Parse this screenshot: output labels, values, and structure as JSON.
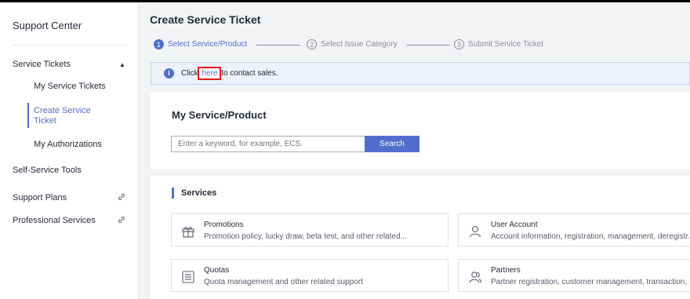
{
  "sidebar": {
    "title": "Support Center",
    "items": [
      {
        "label": "Service Tickets"
      },
      {
        "label": "My Service Tickets"
      },
      {
        "label": "Create Service Ticket"
      },
      {
        "label": "My Authorizations"
      },
      {
        "label": "Self-Service Tools"
      },
      {
        "label": "Support Plans"
      },
      {
        "label": "Professional Services"
      }
    ],
    "active_color": "#526ecc"
  },
  "page": {
    "title": "Create Service Ticket"
  },
  "steps": [
    {
      "num": "1",
      "label": "Select Service/Product",
      "active": true
    },
    {
      "num": "2",
      "label": "Select Issue Category",
      "active": false
    },
    {
      "num": "3",
      "label": "Submit Service Ticket",
      "active": false
    }
  ],
  "notice": {
    "prefix": "Click ",
    "link": "here",
    "suffix": " to contact sales."
  },
  "product": {
    "title": "My Service/Product",
    "search_placeholder": "Enter a keyword, for example, ECS.",
    "search_button": "Search"
  },
  "services": {
    "title": "Services",
    "items": [
      {
        "name": "Promotions",
        "desc": "Promotion policy, lucky draw, beta test, and other related...",
        "icon": "gift-icon"
      },
      {
        "name": "User Account",
        "desc": "Account information, registration, management, deregistr...",
        "icon": "user-icon"
      },
      {
        "name": "Quotas",
        "desc": "Quota management and other related support",
        "icon": "quota-list-icon"
      },
      {
        "name": "Partners",
        "desc": "Partner registration, customer management, transaction, ...",
        "icon": "partners-icon"
      }
    ]
  },
  "colors": {
    "accent": "#526ecc",
    "highlight_box": "#e02020"
  }
}
